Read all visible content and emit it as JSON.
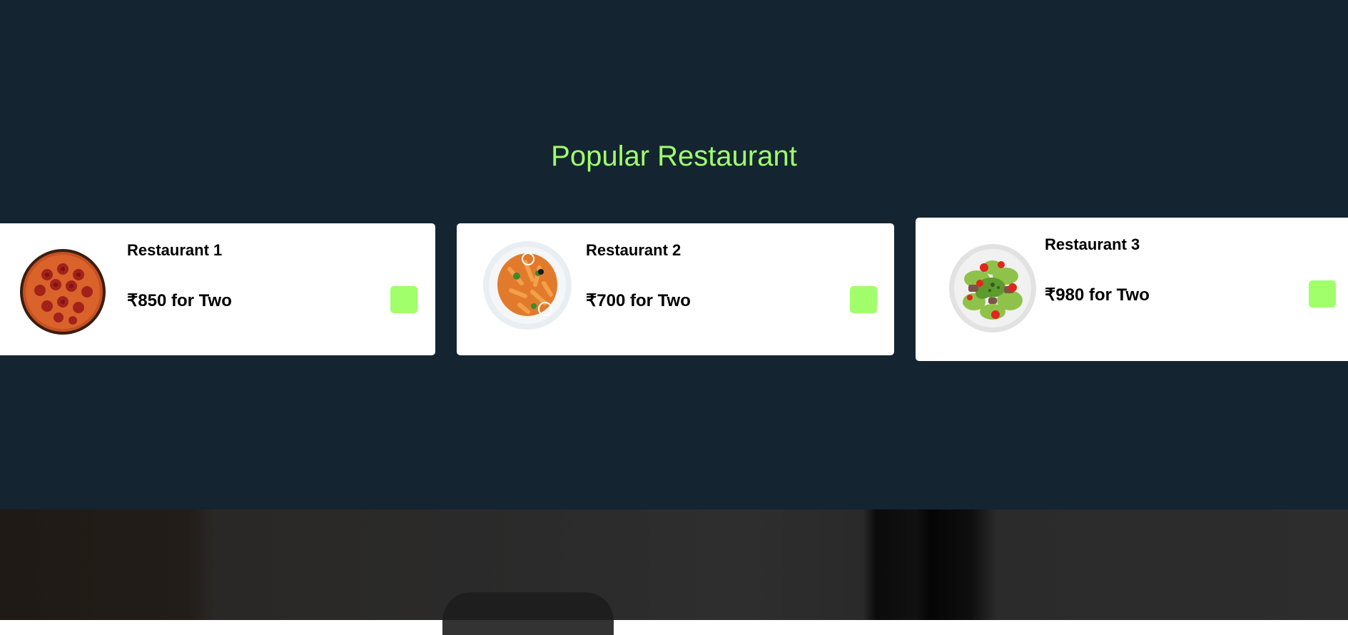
{
  "section": {
    "title": "Popular Restaurant"
  },
  "restaurants": [
    {
      "name": "Restaurant 1",
      "price": "₹850 for Two",
      "dish_icon": "pizza-icon"
    },
    {
      "name": "Restaurant 2",
      "price": "₹700 for Two",
      "dish_icon": "pasta-icon"
    },
    {
      "name": "Restaurant 3",
      "price": "₹980 for Two",
      "dish_icon": "salad-icon"
    }
  ],
  "colors": {
    "background": "#142430",
    "accent": "#a0ff6b",
    "card": "#ffffff"
  }
}
